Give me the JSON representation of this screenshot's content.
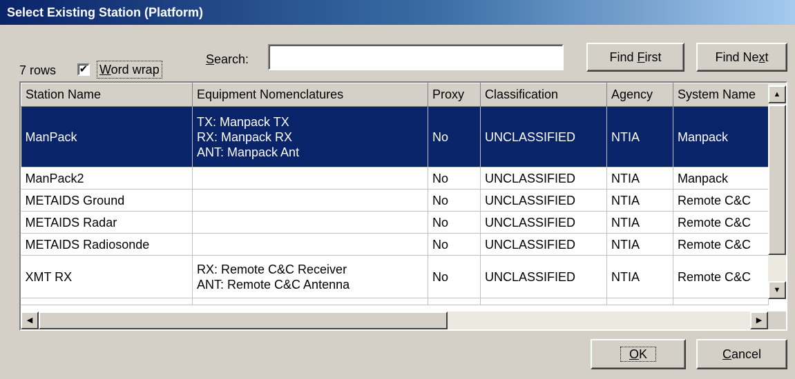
{
  "window": {
    "title": "Select Existing Station (Platform)"
  },
  "toolbar": {
    "row_count": "7 rows",
    "word_wrap_label": "Word wrap",
    "word_wrap_checked": "✔",
    "search_label": "Search:",
    "search_value": "",
    "find_first_label": "Find First",
    "find_next_label": "Find Next"
  },
  "table": {
    "columns": [
      "Station Name",
      "Equipment Nomenclatures",
      "Proxy",
      "Classification",
      "Agency",
      "System Name"
    ],
    "rows": [
      {
        "station": "ManPack",
        "equipment": [
          "TX: Manpack TX",
          "RX: Manpack RX",
          "ANT: Manpack Ant"
        ],
        "proxy": "No",
        "classification": "UNCLASSIFIED",
        "agency": "NTIA",
        "system": "Manpack",
        "selected": true
      },
      {
        "station": "ManPack2",
        "equipment": [],
        "proxy": "No",
        "classification": "UNCLASSIFIED",
        "agency": "NTIA",
        "system": "Manpack"
      },
      {
        "station": "METAIDS Ground",
        "equipment": [],
        "proxy": "No",
        "classification": "UNCLASSIFIED",
        "agency": "NTIA",
        "system": "Remote C&C"
      },
      {
        "station": "METAIDS Radar",
        "equipment": [],
        "proxy": "No",
        "classification": "UNCLASSIFIED",
        "agency": "NTIA",
        "system": "Remote C&C"
      },
      {
        "station": "METAIDS Radiosonde",
        "equipment": [],
        "proxy": "No",
        "classification": "UNCLASSIFIED",
        "agency": "NTIA",
        "system": "Remote C&C"
      },
      {
        "station": "XMT RX",
        "equipment": [
          "RX: Remote C&C Receiver",
          "ANT: Remote C&C Antenna"
        ],
        "proxy": "No",
        "classification": "UNCLASSIFIED",
        "agency": "NTIA",
        "system": "Remote C&C"
      }
    ]
  },
  "buttons": {
    "ok_label": "OK",
    "cancel_label": "Cancel"
  },
  "colors": {
    "selection": "#0a246a",
    "dialog_bg": "#d4d0c8"
  }
}
